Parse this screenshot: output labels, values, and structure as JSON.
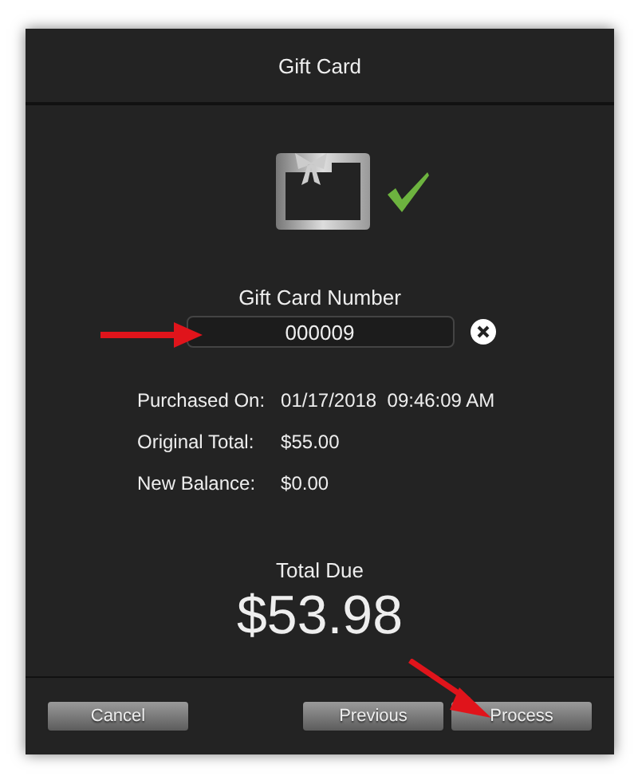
{
  "window": {
    "title": "Gift Card"
  },
  "card": {
    "verified": true
  },
  "field": {
    "label": "Gift Card Number",
    "value": "000009"
  },
  "details": [
    {
      "label": "Purchased On:",
      "value": "01/17/2018  09:46:09 AM"
    },
    {
      "label": "Original Total:",
      "value": "$55.00"
    },
    {
      "label": "New Balance:",
      "value": "$0.00"
    }
  ],
  "total": {
    "label": "Total Due",
    "amount": "$53.98"
  },
  "buttons_left": [
    "Cancel"
  ],
  "buttons_right": [
    "Previous",
    "Process"
  ]
}
